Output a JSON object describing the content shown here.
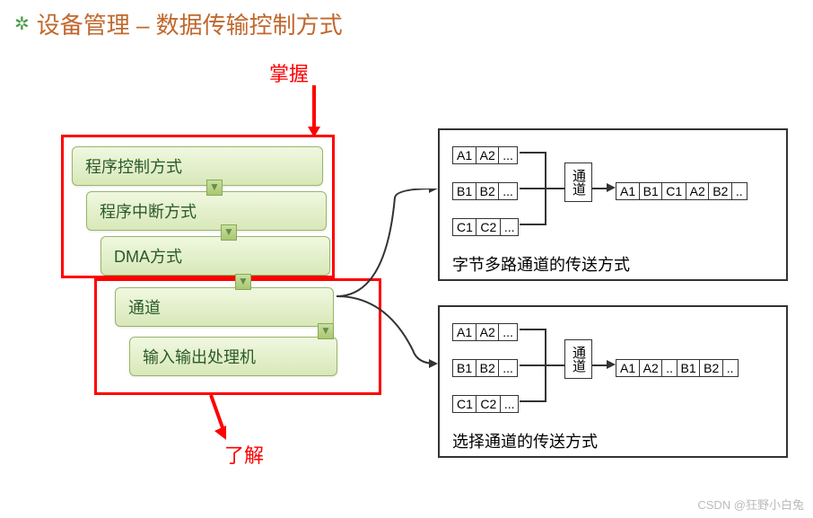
{
  "title": "设备管理 – 数据传输控制方式",
  "annotations": {
    "master": "掌握",
    "understand": "了解"
  },
  "methods": {
    "m1": "程序控制方式",
    "m2": "程序中断方式",
    "m3": "DMA方式",
    "m4": "通道",
    "m5": "输入输出处理机"
  },
  "channel": {
    "node": "通道",
    "inputs": {
      "rowA": [
        "A1",
        "A2",
        "..."
      ],
      "rowB": [
        "B1",
        "B2",
        "..."
      ],
      "rowC": [
        "C1",
        "C2",
        "..."
      ]
    },
    "diagram1": {
      "output": [
        "A1",
        "B1",
        "C1",
        "A2",
        "B2",
        ".."
      ],
      "caption": "字节多路通道的传送方式"
    },
    "diagram2": {
      "output": [
        "A1",
        "A2",
        "..",
        "B1",
        "B2",
        ".."
      ],
      "caption": "选择通道的传送方式"
    }
  },
  "watermark": "CSDN @狂野小白兔"
}
